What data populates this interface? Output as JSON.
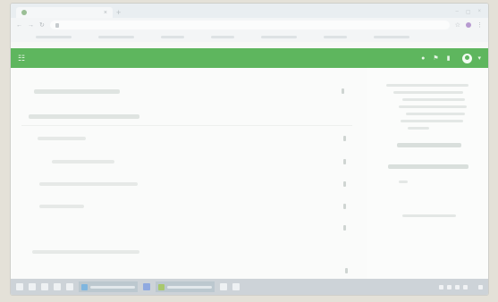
{
  "browser": {
    "tabs": [
      {
        "label": ""
      }
    ],
    "new_tab_glyph": "+",
    "address": ""
  },
  "appbar": {
    "menu_glyph": "☷",
    "user_name": "",
    "icons": [
      "bell-icon",
      "flag-icon",
      "bookmark-icon"
    ]
  },
  "colors": {
    "header_green": "#5eb65e",
    "page_bg": "#f7f8f7",
    "taskbar": "#cdd3d8"
  },
  "taskbar": {
    "apps": [
      "",
      ""
    ],
    "clock": ""
  }
}
